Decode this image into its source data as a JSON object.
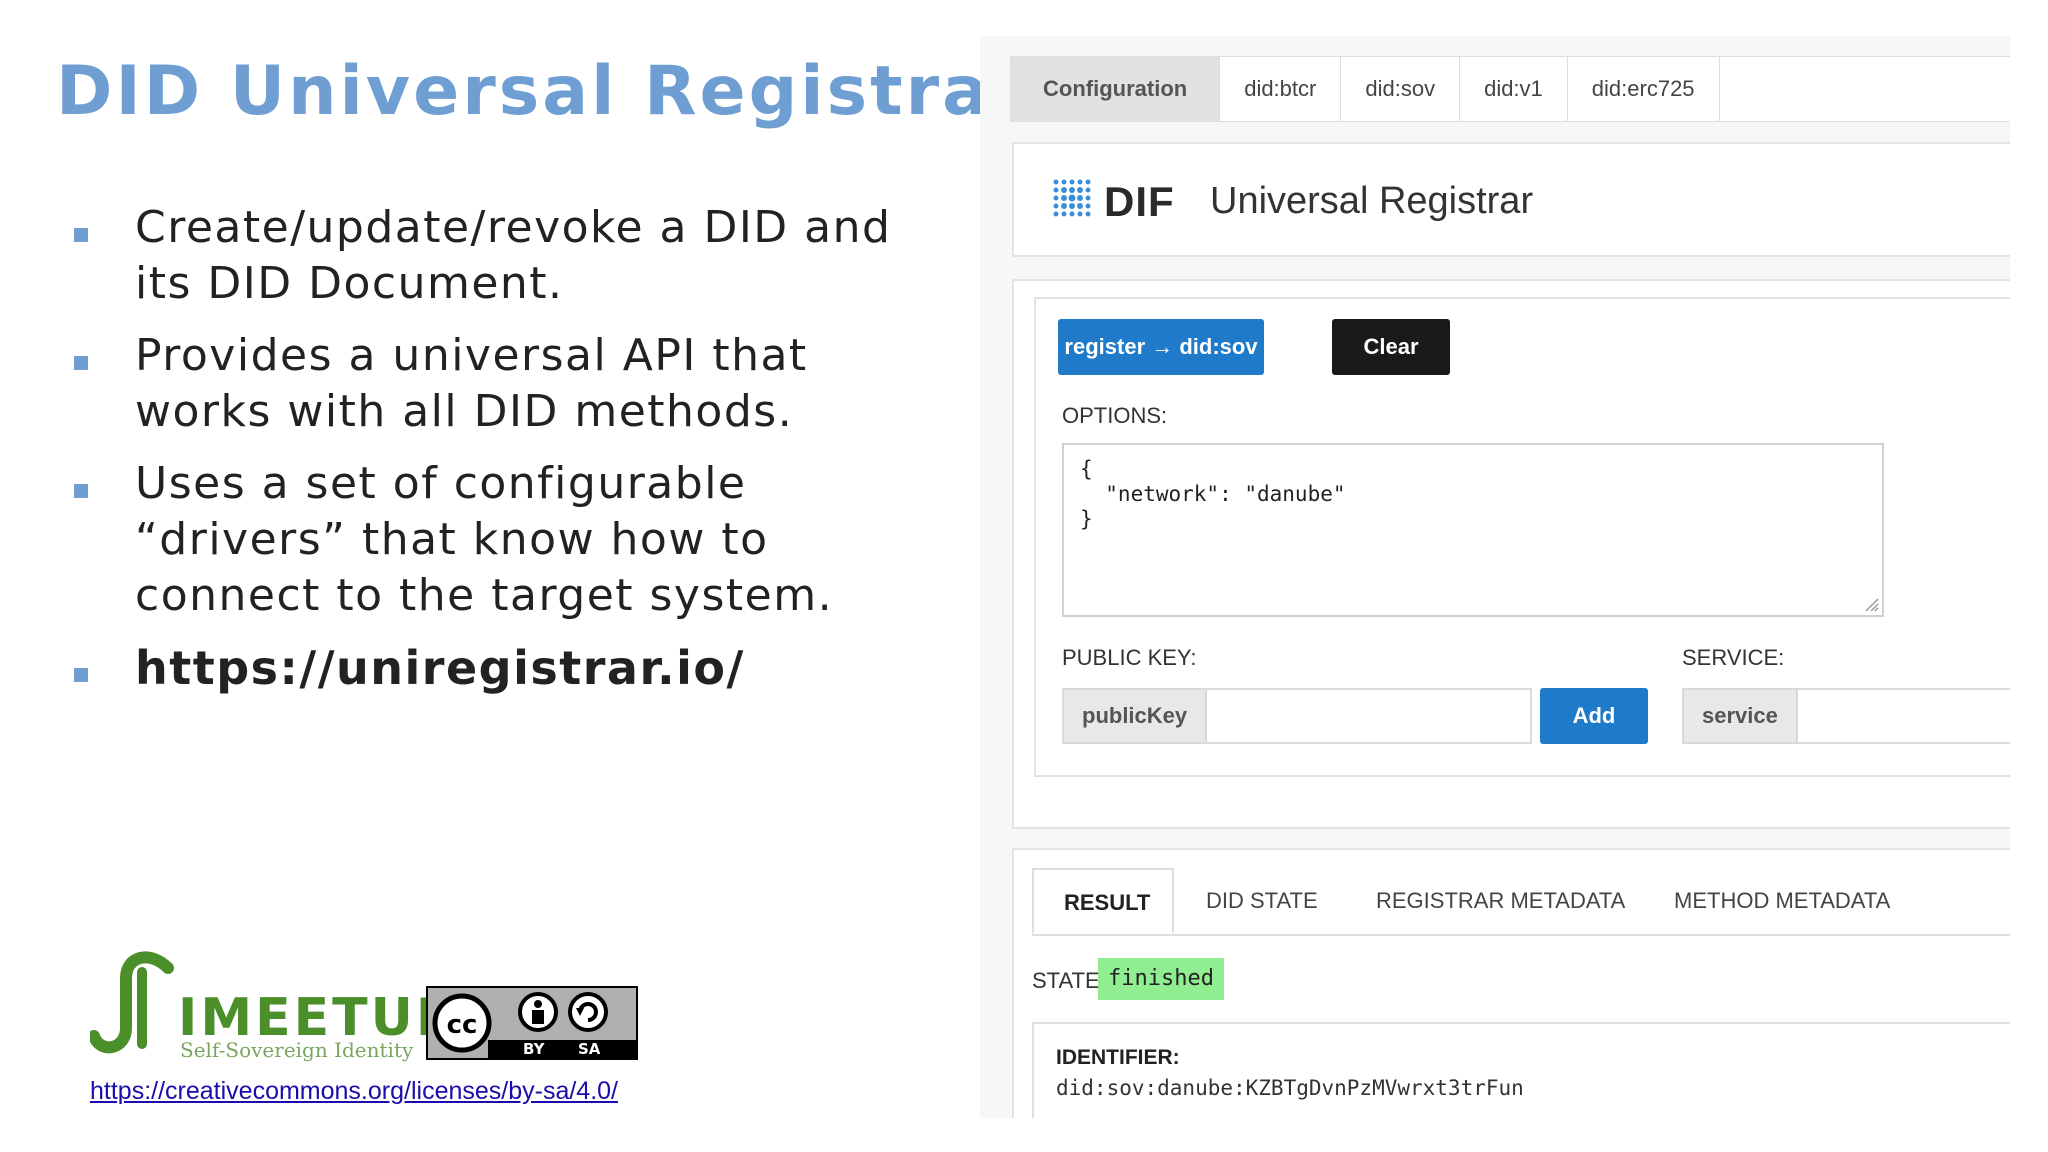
{
  "slide": {
    "title": "DID Universal Registrar",
    "bullets": [
      "Create/update/revoke a DID and its DID Document.",
      "Provides a universal API that works with all DID methods.",
      "Uses a set of configurable “drivers” that know how to connect to the target system.",
      "https://uniregistrar.io/"
    ],
    "logo": {
      "main": "IMEETUP",
      "sub": "Self-Sovereign Identity"
    },
    "cc_badge": {
      "cc": "cc",
      "by": "BY",
      "sa": "SA"
    },
    "license_url": "https://creativecommons.org/licenses/by-sa/4.0/"
  },
  "app": {
    "tabs": [
      "Configuration",
      "did:btcr",
      "did:sov",
      "did:v1",
      "did:erc725"
    ],
    "active_tab": "Configuration",
    "header": {
      "logo_text": "DIF",
      "title": "Universal Registrar"
    },
    "buttons": {
      "register": "register → did:sov",
      "clear": "Clear",
      "add": "Add"
    },
    "options": {
      "label": "OPTIONS:",
      "value": "{\n  \"network\": \"danube\"\n}"
    },
    "public_key": {
      "label": "PUBLIC KEY:",
      "addon": "publicKey"
    },
    "service": {
      "label": "SERVICE:",
      "addon": "service"
    },
    "result_tabs": [
      "RESULT",
      "DID STATE",
      "REGISTRAR METADATA",
      "METHOD METADATA"
    ],
    "active_result_tab": "RESULT",
    "state": {
      "label": "STATE:",
      "value": "finished"
    },
    "identifier": {
      "label": "IDENTIFIER:",
      "value": "did:sov:danube:KZBTgDvnPzMVwrxt3trFun"
    }
  },
  "colors": {
    "title_blue": "#6f9fd2",
    "primary_button": "#1f7ac9",
    "dark_button": "#1a1a1a",
    "finished_badge": "#90ee90",
    "meetup_green": "#4a8f2a"
  }
}
